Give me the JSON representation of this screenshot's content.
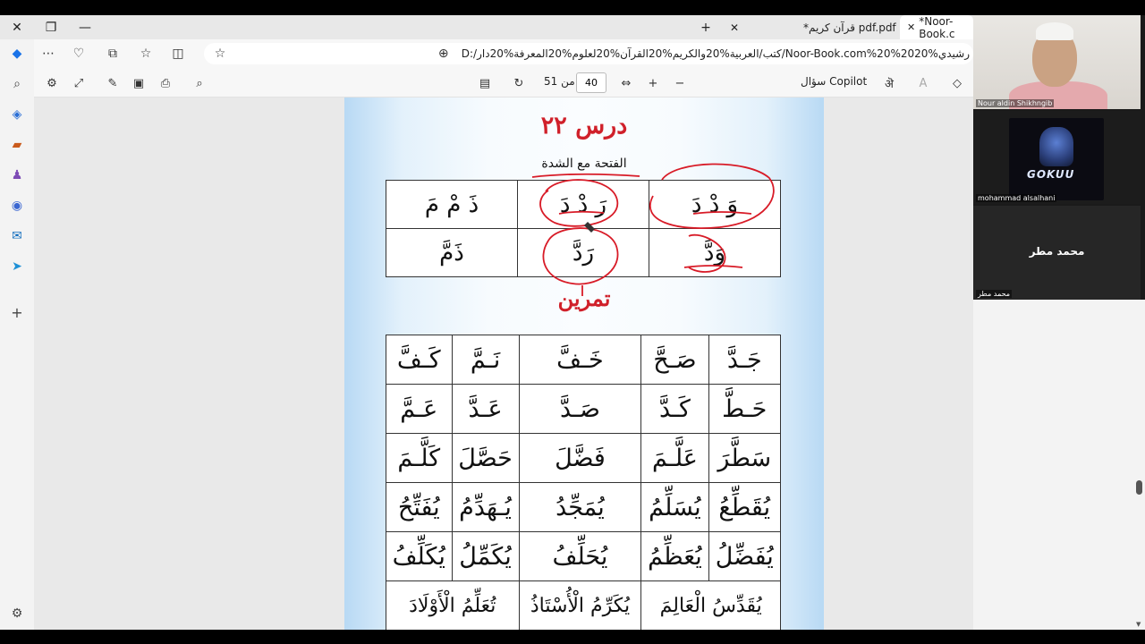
{
  "browser": {
    "tabs": [
      {
        "label": "*Noor-Book.c",
        "active": true
      },
      {
        "label": "*قرآن كريم pdf.pdf",
        "active": false
      }
    ],
    "new_tab_symbol": "+",
    "url": "D:/كتب/العربية%20والكريم%20القرآن%20لعلوم%20المعرفة%20دار/Noor-Book.com%20%20رشيدي%20",
    "window_close": "✕",
    "window_restore": "❐",
    "window_minimize": "—"
  },
  "pdf_toolbar": {
    "current_page": "40",
    "page_of": "من 51",
    "copilot_label": "سؤال Copilot",
    "zoom_in": "+",
    "zoom_out": "−"
  },
  "document": {
    "lesson_title": "درس ٢٢",
    "lesson_subtitle": "الفتحة مع الشدة",
    "exercise_title": "تمرين",
    "example_table": [
      [
        "وَ دْ دَ",
        "رَ دْ دَ",
        "ذَ مْ مَ"
      ],
      [
        "وَدَّ",
        "رَدَّ",
        "ذَمَّ"
      ]
    ],
    "exercise_table": [
      [
        "جَـدَّ",
        "صَـحَّ",
        "خَـفَّ",
        "نَـمَّ",
        "كَـفَّ"
      ],
      [
        "حَـطَّ",
        "كَـدَّ",
        "صَـدَّ",
        "عَـدَّ",
        "عَـمَّ"
      ],
      [
        "سَطَّرَ",
        "عَلَّـمَ",
        "فَضَّلَ",
        "حَصَّلَ",
        "كَلَّـمَ"
      ],
      [
        "يُقَطِّعُ",
        "يُسَلِّمُ",
        "يُمَجِّدُ",
        "يُـهَدِّمُ",
        "يُفَتِّحُ"
      ],
      [
        "يُفَضِّلُ",
        "يُعَظِّمُ",
        "يُحَلِّفُ",
        "يُكَمِّلُ",
        "يُكَلِّفُ"
      ]
    ],
    "exercise_last_row": [
      "يُقَدِّسُ الْعَالِمَ",
      "يُكَرِّمُ الْأُسْتَاذُ",
      "تُعَلِّمُ الْأَوْلَادَ"
    ],
    "annotation_color": "#d81b27"
  },
  "participants": [
    {
      "name": "Nour aldin Shikhngib"
    },
    {
      "name": "mohammad alsalhani",
      "logo_text": "GOKUU"
    },
    {
      "name": "محمد مطر",
      "display": "محمد مطر"
    }
  ],
  "colors": {
    "accent_red": "#d0202a",
    "page_blue": "#b8d9f4"
  }
}
